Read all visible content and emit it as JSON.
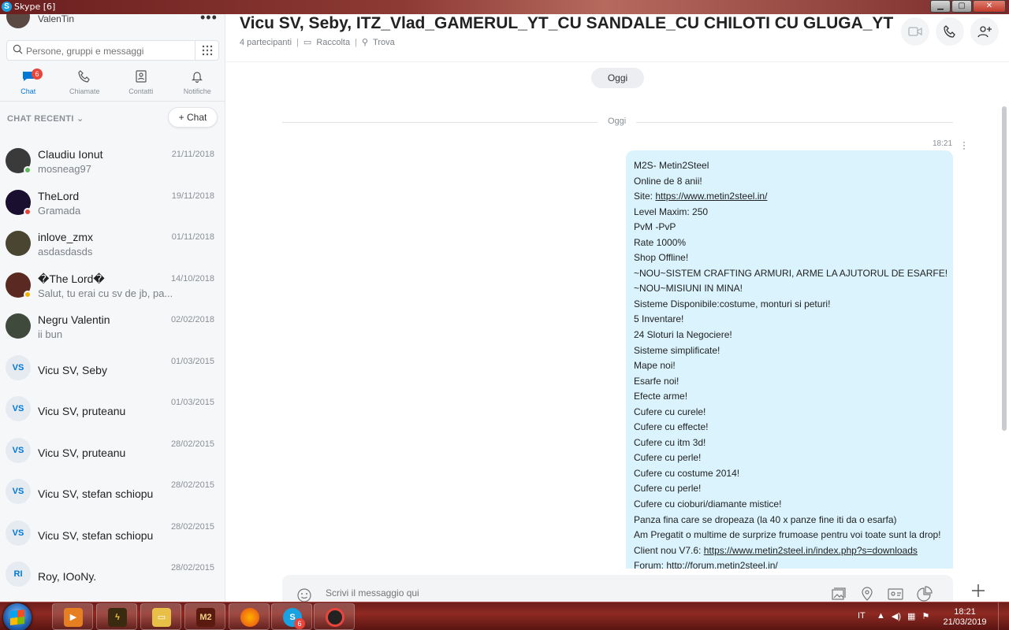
{
  "window": {
    "title": "Skype [6]",
    "buttons": {
      "minimize": "▁",
      "maximize": "▢",
      "close": "✕"
    }
  },
  "profile": {
    "name": "ValenTin",
    "menu": "•••"
  },
  "search": {
    "placeholder": "Persone, gruppi e messaggi",
    "value": ""
  },
  "nav": {
    "tabs": [
      {
        "label": "Chat",
        "badge": "6"
      },
      {
        "label": "Chiamate"
      },
      {
        "label": "Contatti"
      },
      {
        "label": "Notifiche"
      }
    ]
  },
  "recent": {
    "header": "CHAT RECENTI",
    "new_chat_label": "+ Chat"
  },
  "chats": [
    {
      "name": "Claudiu Ionut",
      "preview": "mosneag97",
      "date": "21/11/2018",
      "status": "online",
      "avatar_color": "#3a3a3a"
    },
    {
      "name": "TheLord",
      "preview": "Gramada",
      "date": "19/11/2018",
      "status": "busy",
      "avatar_color": "#1a0f2e"
    },
    {
      "name": "inlove_zmx",
      "preview": "asdasdasds",
      "date": "01/11/2018",
      "status": "none",
      "avatar_color": "#4a4530"
    },
    {
      "name": "�The Lord�",
      "preview": "Salut, tu erai cu sv de jb, pa...",
      "date": "14/10/2018",
      "status": "away",
      "avatar_color": "#5a2a22"
    },
    {
      "name": "Negru Valentin",
      "preview": "ii bun",
      "date": "02/02/2018",
      "status": "none",
      "avatar_color": "#3f4a3c"
    },
    {
      "name": "Vicu SV, Seby",
      "preview": "",
      "date": "01/03/2015",
      "initials": "VS"
    },
    {
      "name": "Vicu SV, pruteanu",
      "preview": "",
      "date": "01/03/2015",
      "initials": "VS"
    },
    {
      "name": "Vicu SV, pruteanu",
      "preview": "",
      "date": "28/02/2015",
      "initials": "VS"
    },
    {
      "name": "Vicu SV, stefan schiopu",
      "preview": "",
      "date": "28/02/2015",
      "initials": "VS"
    },
    {
      "name": "Vicu SV, stefan schiopu",
      "preview": "",
      "date": "28/02/2015",
      "initials": "VS"
    },
    {
      "name": "Roy, IOoNy.",
      "preview": "",
      "date": "28/02/2015",
      "initials": "RI"
    }
  ],
  "conversation": {
    "title": "Vicu SV, Seby, ITZ_Vlad_GAMERUL_YT_CU SANDALE_CU CHILOTI CU GLUGA_YT",
    "participants": "4 partecipanti",
    "gallery": "Raccolta",
    "find": "Trova",
    "today_pill": "Oggi",
    "separator": "Oggi",
    "message_time": "18:21",
    "message_lines": [
      "M2S- Metin2Steel",
      "Online de 8 anii!",
      "Site: |https://www.metin2steel.in/",
      "Level Maxim: 250",
      "PvM -PvP",
      "Rate 1000%",
      "Shop Offline!",
      "~NOU~SISTEM CRAFTING ARMURI, ARME LA AJUTORUL DE ESARFE!",
      "~NOU~MISIUNI IN MINA!",
      "Sisteme Disponibile:costume, monturi si peturi!",
      "5 Inventare!",
      "24 Sloturi la Negociere!",
      "Sisteme simplificate!",
      "Mape noi!",
      "Esarfe noi!",
      "Efecte arme!",
      "Cufere cu curele!",
      "Cufere cu effecte!",
      "Cufere cu itm 3d!",
      "Cufere cu perle!",
      "Cufere cu costume 2014!",
      "Cufere cu perle!",
      "Cufere cu cioburi/diamante mistice!",
      "Panza fina care se dropeaza (la 40 x panze fine iti da o esarfa)",
      "Am Pregatit o multime de surprize frumoase pentru voi toate sunt la drop!",
      "Client nou V7.6: |https://www.metin2steel.in/index.php?s=downloads",
      "Forum: http://forum.metin2steel.in/"
    ],
    "composer_placeholder": "Scrivi il messaggio qui"
  },
  "taskbar": {
    "skype_badge": "6",
    "m2_label": "M2",
    "lang": "IT",
    "time": "18:21",
    "date": "21/03/2019"
  },
  "colors": {
    "accent": "#0078d4",
    "bubble": "#daf3fd",
    "badge": "#e8453c",
    "online": "#5cb85c"
  }
}
